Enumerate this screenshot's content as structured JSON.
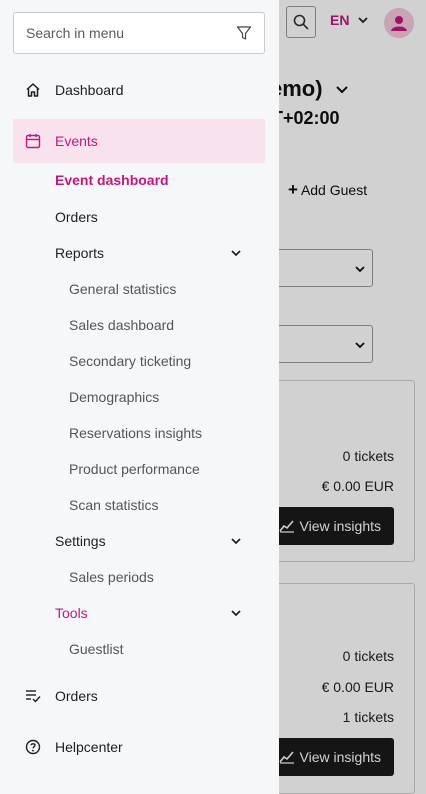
{
  "background": {
    "language": "EN",
    "title": "emo)",
    "subtitle": "T+02:00",
    "add_guest": "Add Guest",
    "card1": {
      "tickets": "0 tickets",
      "revenue": "€ 0.00 EUR",
      "button": "View insights"
    },
    "card2": {
      "tickets": "0 tickets",
      "revenue": "€ 0.00 EUR",
      "extra_tickets": "1 tickets",
      "button": "View insights"
    }
  },
  "menu": {
    "search_placeholder": "Search in menu",
    "dashboard": "Dashboard",
    "events": "Events",
    "event_dashboard": "Event dashboard",
    "orders_sub": "Orders",
    "reports": "Reports",
    "reports_items": [
      "General statistics",
      "Sales dashboard",
      "Secondary ticketing",
      "Demographics",
      "Reservations insights",
      "Product performance",
      "Scan statistics"
    ],
    "settings": "Settings",
    "settings_items": [
      "Sales periods"
    ],
    "tools": "Tools",
    "tools_items": [
      "Guestlist"
    ],
    "orders": "Orders",
    "helpcenter": "Helpcenter"
  },
  "colors": {
    "accent": "#c4167f",
    "active_bg": "#f8e2ee",
    "menu_bg": "#f6f7f8"
  },
  "icons": [
    "filter-icon",
    "home-icon",
    "calendar-icon",
    "chevron-down-icon",
    "orders-list-icon",
    "help-circle-icon",
    "search-icon",
    "user-icon",
    "plus-icon",
    "chart-icon"
  ]
}
